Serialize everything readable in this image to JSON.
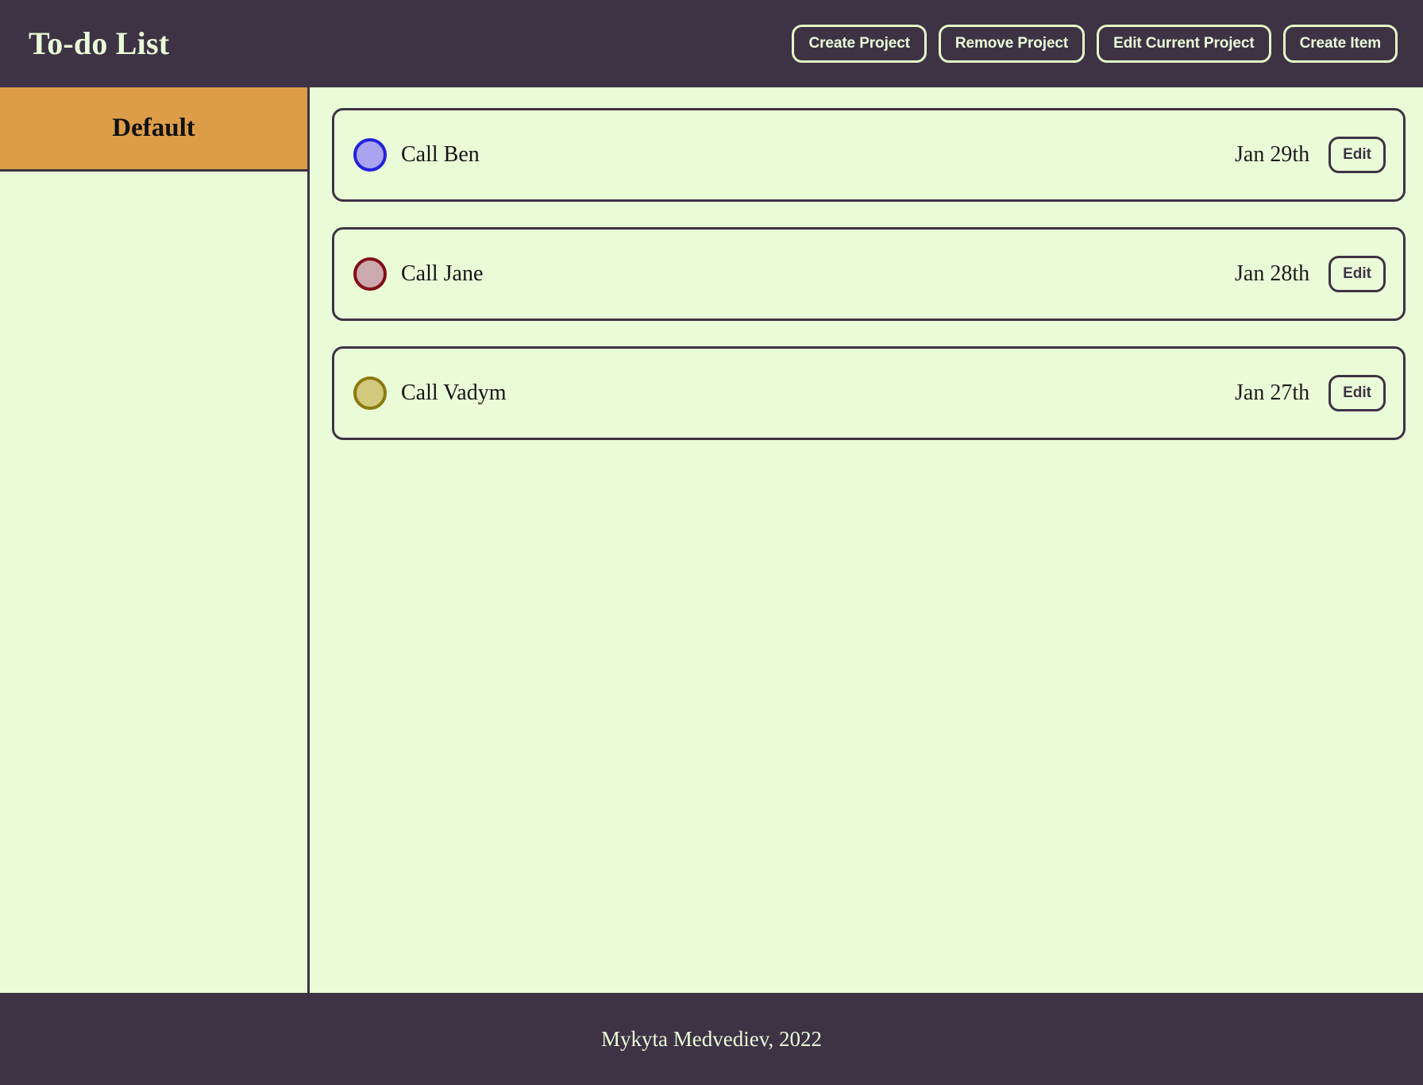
{
  "header": {
    "title": "To-do List",
    "buttons": [
      {
        "label": "Create Project",
        "name": "create-project-button"
      },
      {
        "label": "Remove Project",
        "name": "remove-project-button"
      },
      {
        "label": "Edit Current Project",
        "name": "edit-current-project-button"
      },
      {
        "label": "Create Item",
        "name": "create-item-button"
      }
    ]
  },
  "sidebar": {
    "projects": [
      {
        "label": "Default",
        "selected": true
      }
    ]
  },
  "main": {
    "items": [
      {
        "title": "Call Ben",
        "date": "Jan 29th",
        "edit_label": "Edit",
        "dot_fill": "#a9a4ef",
        "dot_border": "#2222dd"
      },
      {
        "title": "Call Jane",
        "date": "Jan 28th",
        "edit_label": "Edit",
        "dot_fill": "#cba9ad",
        "dot_border": "#820d16"
      },
      {
        "title": "Call Vadym",
        "date": "Jan 27th",
        "edit_label": "Edit",
        "dot_fill": "#d3c97d",
        "dot_border": "#8a7a0e"
      }
    ]
  },
  "footer": {
    "text": "Mykyta Medvediev, 2022"
  },
  "colors": {
    "dark": "#3d3345",
    "light_green": "#eafbd8",
    "orange": "#dd9d48"
  }
}
